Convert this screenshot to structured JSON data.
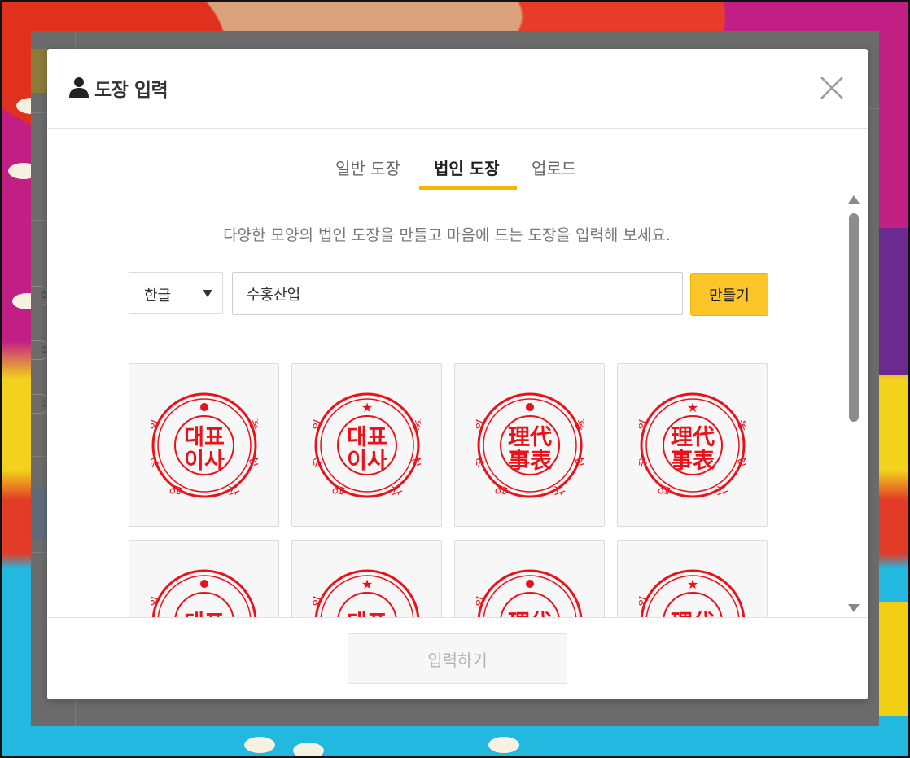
{
  "modal": {
    "title": "도장 입력",
    "icon": "user-icon",
    "close_icon": "close-icon"
  },
  "tabs": [
    {
      "label": "일반 도장",
      "active": false
    },
    {
      "label": "법인 도장",
      "active": true
    },
    {
      "label": "업로드",
      "active": false
    }
  ],
  "accent_color": "#f5b800",
  "description": "다양한 모양의 법인 도장을 만들고 마음에 드는 도장을 입력해 보세요.",
  "form": {
    "language_selected": "한글",
    "name_value": "수홍산업",
    "make_button": "만들기"
  },
  "stamps": {
    "color": "#e8121b",
    "items": [
      {
        "center_top": "대표",
        "center_bottom": "이사",
        "top_mark": "dot",
        "ring_text": [
          "회",
          "수",
          "홍",
          "산",
          "업",
          "사"
        ]
      },
      {
        "center_top": "대표",
        "center_bottom": "이사",
        "top_mark": "star",
        "ring_text": [
          "회",
          "수",
          "홍",
          "산",
          "업",
          "사"
        ]
      },
      {
        "center_top": "理代",
        "center_bottom": "事表",
        "top_mark": "dot",
        "ring_text": [
          "회",
          "수",
          "홍",
          "산",
          "업",
          "사"
        ]
      },
      {
        "center_top": "理代",
        "center_bottom": "事表",
        "top_mark": "star",
        "ring_text": [
          "회",
          "수",
          "홍",
          "산",
          "업",
          "사"
        ]
      },
      {
        "center_top": "대표",
        "center_bottom": "",
        "top_mark": "dot",
        "ring_text": [
          "회",
          "사"
        ]
      },
      {
        "center_top": "대표",
        "center_bottom": "",
        "top_mark": "star",
        "ring_text": [
          "회",
          "사"
        ]
      },
      {
        "center_top": "理代",
        "center_bottom": "",
        "top_mark": "dot",
        "ring_text": [
          "회",
          "사"
        ]
      },
      {
        "center_top": "理代",
        "center_bottom": "",
        "top_mark": "star",
        "ring_text": [
          "회",
          "사"
        ]
      }
    ]
  },
  "footer": {
    "submit_button": "입력하기",
    "submit_enabled": false
  }
}
